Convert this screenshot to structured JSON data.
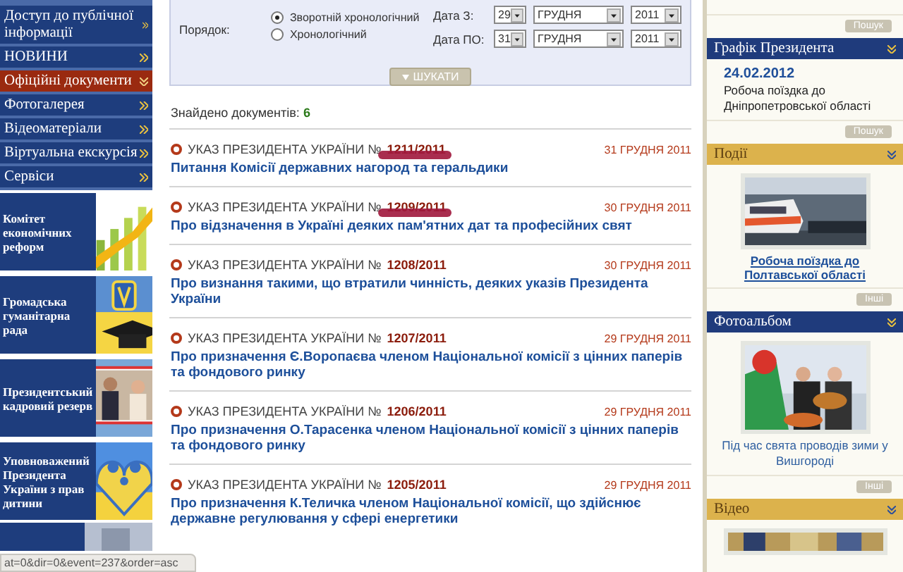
{
  "nav": {
    "items": [
      {
        "label": "Доступ до публічної інформації",
        "selected": false
      },
      {
        "label": "НОВИНИ",
        "selected": false
      },
      {
        "label": "Офіційні документи",
        "selected": true
      },
      {
        "label": "Фотогалерея",
        "selected": false
      },
      {
        "label": "Відеоматеріали",
        "selected": false
      },
      {
        "label": "Віртуальна екскурсія",
        "selected": false
      },
      {
        "label": "Сервіси",
        "selected": false
      }
    ]
  },
  "banners": [
    {
      "title": "Комітет економічних реформ",
      "kind": "chart"
    },
    {
      "title": "Громадська гуманітарна рада",
      "kind": "emblem"
    },
    {
      "title": "Президентський кадровий резерв"
    },
    {
      "title": "Уповноважений Президента України з прав дитини",
      "kind": "family"
    }
  ],
  "filter": {
    "order_label": "Порядок:",
    "options": [
      {
        "label": "Зворотній хронологічний",
        "selected": true
      },
      {
        "label": "Хронологічний",
        "selected": false
      }
    ],
    "dates": [
      {
        "label": "Дата З:",
        "day": "29",
        "month": "ГРУДНЯ",
        "year": "2011"
      },
      {
        "label": "Дата ПО:",
        "day": "31",
        "month": "ГРУДНЯ",
        "year": "2011"
      }
    ],
    "search_button": "ШУКАТИ"
  },
  "found": {
    "label": "Знайдено документів:",
    "count": "6"
  },
  "documents": [
    {
      "type": "УКАЗ ПРЕЗИДЕНТА УКРАЇНИ №",
      "number": "1211/2011",
      "date": "31 ГРУДНЯ 2011",
      "title": "Питання Комісії державних нагород та геральдики",
      "marked": true
    },
    {
      "type": "УКАЗ ПРЕЗИДЕНТА УКРАЇНИ №",
      "number": "1209/2011",
      "date": "30 ГРУДНЯ 2011",
      "title": "Про відзначення в Україні деяких пам'ятних дат та професійних свят",
      "marked": true
    },
    {
      "type": "УКАЗ ПРЕЗИДЕНТА УКРАЇНИ №",
      "number": "1208/2011",
      "date": "30 ГРУДНЯ 2011",
      "title": "Про визнання такими, що втратили чинність, деяких указів Президента України",
      "marked": false
    },
    {
      "type": "УКАЗ ПРЕЗИДЕНТА УКРАЇНИ №",
      "number": "1207/2011",
      "date": "29 ГРУДНЯ 2011",
      "title": "Про призначення Є.Воропаєва членом Національної комісії з цінних паперів та фондового ринку",
      "marked": false
    },
    {
      "type": "УКАЗ ПРЕЗИДЕНТА УКРАЇНИ №",
      "number": "1206/2011",
      "date": "29 ГРУДНЯ 2011",
      "title": "Про призначення О.Тарасенка членом Національної комісії з цінних паперів та фондового ринку",
      "marked": false
    },
    {
      "type": "УКАЗ ПРЕЗИДЕНТА УКРАЇНИ №",
      "number": "1205/2011",
      "date": "29 ГРУДНЯ 2011",
      "title": "Про призначення К.Теличка членом Національної комісії, що здійснює державне регулювання у сфері енергетики",
      "marked": false
    }
  ],
  "sidebar": {
    "items": [
      {
        "kind": "button",
        "label": "Пошук"
      },
      {
        "kind": "header",
        "label": "Графік Президента",
        "color": "#1f3b7c"
      },
      {
        "kind": "date",
        "label": "24.02.2012"
      },
      {
        "kind": "text",
        "label": "Робоча поїздка до Дніпропетровської області"
      },
      {
        "kind": "button",
        "label": "Пошук"
      },
      {
        "kind": "header",
        "label": "Події",
        "color": "#dcb24c"
      },
      {
        "kind": "picture"
      },
      {
        "kind": "link",
        "label": "Робоча поїздка до Полтавської області"
      },
      {
        "kind": "button",
        "label": "Інші"
      },
      {
        "kind": "header",
        "label": "Фотоальбом",
        "color": "#1f3b7c"
      },
      {
        "kind": "picture"
      },
      {
        "kind": "caption",
        "label": "Під час свята проводів зими у Вишгороді"
      },
      {
        "kind": "button",
        "label": "Інші"
      },
      {
        "kind": "header",
        "label": "Відео",
        "color": "#dcb24c"
      },
      {
        "kind": "picture"
      }
    ]
  },
  "status_bar": "at=0&dir=0&event=237&order=asc"
}
